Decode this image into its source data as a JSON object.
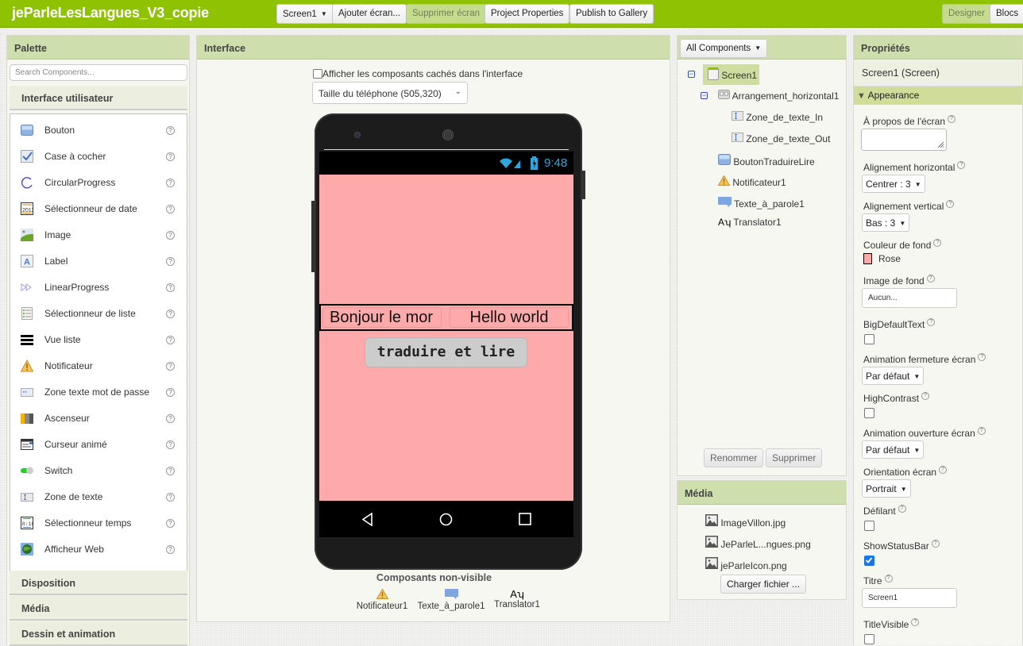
{
  "app": {
    "title": "jeParleLesLangues_V3_copie",
    "screen_selector": "Screen1",
    "add_screen": "Ajouter écran...",
    "remove_screen": "Supprimer écran",
    "project_properties": "Project Properties",
    "publish": "Publish to Gallery",
    "designer": "Designer",
    "blocks": "Blocs"
  },
  "palette": {
    "title": "Palette",
    "search_placeholder": "Search Components...",
    "group_open": "Interface utilisateur",
    "items": [
      {
        "label": "Bouton",
        "icon": "button-icon"
      },
      {
        "label": "Case à cocher",
        "icon": "checkbox-icon"
      },
      {
        "label": "CircularProgress",
        "icon": "circular-progress-icon"
      },
      {
        "label": "Sélectionneur de date",
        "icon": "date-picker-icon"
      },
      {
        "label": "Image",
        "icon": "image-icon"
      },
      {
        "label": "Label",
        "icon": "label-icon"
      },
      {
        "label": "LinearProgress",
        "icon": "linear-progress-icon"
      },
      {
        "label": "Sélectionneur de liste",
        "icon": "list-picker-icon"
      },
      {
        "label": "Vue liste",
        "icon": "list-view-icon"
      },
      {
        "label": "Notificateur",
        "icon": "notifier-icon"
      },
      {
        "label": "Zone texte mot de passe",
        "icon": "password-textbox-icon"
      },
      {
        "label": "Ascenseur",
        "icon": "slider-icon"
      },
      {
        "label": "Curseur animé",
        "icon": "spinner-icon"
      },
      {
        "label": "Switch",
        "icon": "switch-icon"
      },
      {
        "label": "Zone de texte",
        "icon": "textbox-icon"
      },
      {
        "label": "Sélectionneur temps",
        "icon": "time-picker-icon"
      },
      {
        "label": "Afficheur Web",
        "icon": "web-viewer-icon"
      }
    ],
    "help_glyph": "?",
    "groups_closed": [
      "Disposition",
      "Média",
      "Dessin et animation"
    ]
  },
  "viewer": {
    "title": "Interface",
    "show_hidden_label": "Afficher les composants cachés dans l'interface",
    "phone_size": "Taille du téléphone (505,320)",
    "status_time": "9:48",
    "textbox_in": "Bonjour le mor",
    "textbox_out": "Hello world",
    "button_label": "traduire et lire",
    "screen_color": "#ffaaaa",
    "nonvisible_title": "Composants non-visible",
    "nonvisible": [
      {
        "label": "Notificateur1",
        "icon": "notifier-icon"
      },
      {
        "label": "Texte_à_parole1",
        "icon": "text-to-speech-icon"
      },
      {
        "label": "Translator1",
        "icon": "translator-icon"
      }
    ]
  },
  "components": {
    "filter": "All Components",
    "tree": [
      {
        "label": "Screen1",
        "level": 0,
        "icon": "screen-icon",
        "selected": true
      },
      {
        "label": "Arrangement_horizontal1",
        "level": 1,
        "icon": "horizontal-arrangement-icon"
      },
      {
        "label": "Zone_de_texte_In",
        "level": 2,
        "icon": "textbox-icon"
      },
      {
        "label": "Zone_de_texte_Out",
        "level": 2,
        "icon": "textbox-icon"
      },
      {
        "label": "BoutonTraduireLire",
        "level": 1,
        "icon": "button-icon"
      },
      {
        "label": "Notificateur1",
        "level": 1,
        "icon": "notifier-icon"
      },
      {
        "label": "Texte_à_parole1",
        "level": 1,
        "icon": "text-to-speech-icon"
      },
      {
        "label": "Translator1",
        "level": 1,
        "icon": "translator-icon"
      }
    ],
    "rename": "Renommer",
    "delete": "Supprimer"
  },
  "media": {
    "title": "Média",
    "files": [
      "ImageVillon.jpg",
      "JeParleL...ngues.png",
      "jeParleIcon.png"
    ],
    "upload": "Charger fichier ..."
  },
  "properties": {
    "title": "Propriétés",
    "subject": "Screen1 (Screen)",
    "section": "Appearance",
    "about_label": "À propos de l'écran",
    "about_value": "",
    "halign_label": "Alignement horizontal",
    "halign_value": "Centrer : 3",
    "valign_label": "Alignement vertical",
    "valign_value": "Bas : 3",
    "bgcolor_label": "Couleur de fond",
    "bgcolor_value": "Rose",
    "bgcolor_swatch": "#ffaaaa",
    "bgimage_label": "Image de fond",
    "bgimage_value": "Aucun...",
    "bigtext_label": "BigDefaultText",
    "bigtext_checked": false,
    "close_anim_label": "Animation fermeture écran",
    "close_anim_value": "Par défaut",
    "highcontrast_label": "HighContrast",
    "highcontrast_checked": false,
    "open_anim_label": "Animation ouverture écran",
    "open_anim_value": "Par défaut",
    "orientation_label": "Orientation écran",
    "orientation_value": "Portrait",
    "scrollable_label": "Défilant",
    "scrollable_checked": false,
    "statusbar_label": "ShowStatusBar",
    "statusbar_checked": true,
    "title_label": "Titre",
    "title_value": "Screen1",
    "titlevisible_label": "TitleVisible",
    "titlevisible_checked": false
  }
}
